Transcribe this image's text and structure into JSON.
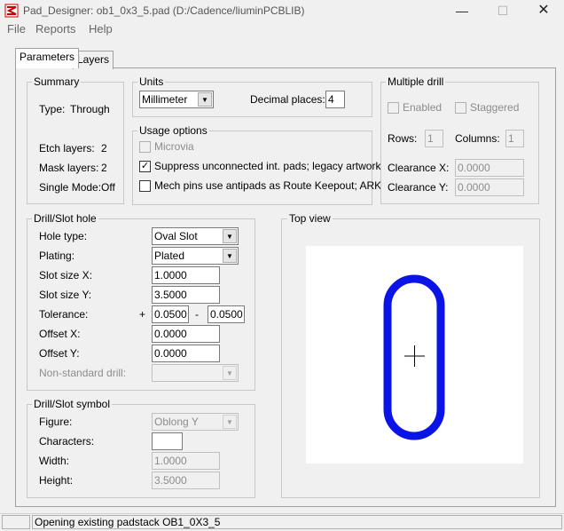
{
  "window": {
    "title": "Pad_Designer: ob1_0x3_5.pad (D:/Cadence/liuminPCBLIB)",
    "controls": {
      "minimize": "—",
      "maximize": "☐",
      "close": "✕"
    }
  },
  "menu": [
    "File",
    "Reports",
    "Help"
  ],
  "tabs": [
    {
      "label": "Parameters",
      "active": true
    },
    {
      "label": "Layers",
      "active": false
    }
  ],
  "summary": {
    "title": "Summary",
    "type_label": "Type:",
    "type_value": "Through",
    "etch_label": "Etch layers:",
    "etch_value": "2",
    "mask_label": "Mask layers:",
    "mask_value": "2",
    "single_label": "Single Mode:",
    "single_value": "Off"
  },
  "units": {
    "title": "Units",
    "unit_value": "Millimeter",
    "decimal_label": "Decimal places:",
    "decimal_value": "4"
  },
  "usage": {
    "title": "Usage options",
    "microvia": {
      "label": "Microvia",
      "checked": false,
      "enabled": false
    },
    "suppress": {
      "label": "Suppress unconnected int. pads; legacy artwork",
      "checked": true,
      "enabled": true
    },
    "mech": {
      "label": "Mech pins use antipads as Route Keepout; ARK",
      "checked": false,
      "enabled": true
    }
  },
  "multiple_drill": {
    "title": "Multiple drill",
    "enabled_label": "Enabled",
    "staggered_label": "Staggered",
    "rows_label": "Rows:",
    "rows_value": "1",
    "columns_label": "Columns:",
    "columns_value": "1",
    "clearance_x_label": "Clearance X:",
    "clearance_x_value": "0.0000",
    "clearance_y_label": "Clearance Y:",
    "clearance_y_value": "0.0000"
  },
  "drill_hole": {
    "title": "Drill/Slot hole",
    "hole_type_label": "Hole type:",
    "hole_type_value": "Oval Slot",
    "plating_label": "Plating:",
    "plating_value": "Plated",
    "slot_x_label": "Slot size X:",
    "slot_x_value": "1.0000",
    "slot_y_label": "Slot size Y:",
    "slot_y_value": "3.5000",
    "tolerance_label": "Tolerance:",
    "tolerance_plus_sign": "+",
    "tolerance_plus_value": "0.0500",
    "tolerance_minus_sign": "-",
    "tolerance_minus_value": "0.0500",
    "offset_x_label": "Offset X:",
    "offset_x_value": "0.0000",
    "offset_y_label": "Offset Y:",
    "offset_y_value": "0.0000",
    "nonstd_label": "Non-standard drill:",
    "nonstd_value": ""
  },
  "drill_symbol": {
    "title": "Drill/Slot symbol",
    "figure_label": "Figure:",
    "figure_value": "Oblong Y",
    "characters_label": "Characters:",
    "characters_value": "",
    "width_label": "Width:",
    "width_value": "1.0000",
    "height_label": "Height:",
    "height_value": "3.5000"
  },
  "top_view": {
    "title": "Top view",
    "slot_color": "#0a14e6"
  },
  "status": {
    "message": "Opening existing padstack OB1_0X3_5"
  }
}
